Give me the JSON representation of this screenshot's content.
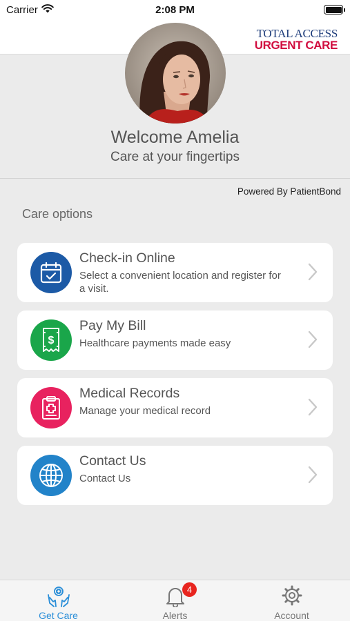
{
  "status_bar": {
    "carrier": "Carrier",
    "time": "2:08 PM"
  },
  "brand": {
    "line1": "TOTAL ACCESS",
    "line2": "URGENT CARE"
  },
  "profile": {
    "welcome": "Welcome Amelia",
    "tagline": "Care at your fingertips"
  },
  "powered_by": "Powered By PatientBond",
  "section_title": "Care options",
  "options": [
    {
      "title": "Check-in Online",
      "subtitle": "Select a convenient location and register for a visit.",
      "icon": "calendar-check-icon",
      "color": "#1c5aa6"
    },
    {
      "title": "Pay My Bill",
      "subtitle": "Healthcare payments made easy",
      "icon": "receipt-dollar-icon",
      "color": "#1aa64a"
    },
    {
      "title": "Medical Records",
      "subtitle": "Manage your medical record",
      "icon": "clipboard-medical-icon",
      "color": "#e8225f"
    },
    {
      "title": "Contact Us",
      "subtitle": "Contact Us",
      "icon": "globe-icon",
      "color": "#2283c9"
    }
  ],
  "tabs": [
    {
      "label": "Get Care",
      "icon": "hands-care-icon",
      "active": true
    },
    {
      "label": "Alerts",
      "icon": "bell-icon",
      "badge": "4"
    },
    {
      "label": "Account",
      "icon": "gear-icon"
    }
  ],
  "colors": {
    "accent": "#2a8ed8",
    "brand_blue": "#1d3c7a",
    "brand_red": "#d10d3f",
    "badge": "#e8251f"
  }
}
